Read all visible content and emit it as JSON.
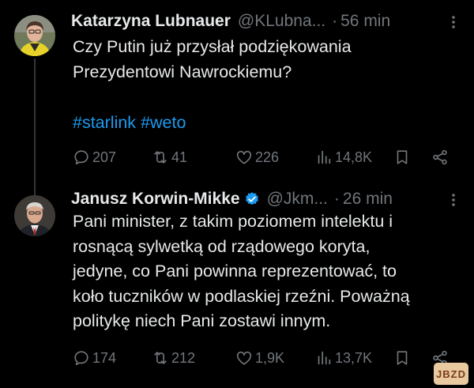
{
  "tweets": [
    {
      "author": "Katarzyna Lubnauer",
      "handle": "@KLubna...",
      "separator": "·",
      "time": "56 min",
      "verified": false,
      "text_lines": [
        "Czy Putin już przysłał podziękowania",
        "Prezydentowi Nawrockiemu?"
      ],
      "hashtags": [
        "#starlink",
        "#weto"
      ],
      "stats": {
        "replies": "207",
        "reposts": "41",
        "likes": "226",
        "views": "14,8K"
      }
    },
    {
      "author": "Janusz Korwin-Mikke",
      "handle": "@Jkm...",
      "separator": "·",
      "time": "26 min",
      "verified": true,
      "text_lines": [
        "Pani minister, z takim poziomem intelektu i",
        "rosnącą sylwetką od rządowego koryta,",
        "jedyne, co Pani powinna reprezentować, to",
        "koło tuczników w podlaskiej rzeźni. Poważną",
        "politykę niech Pani zostawi innym."
      ],
      "stats": {
        "replies": "174",
        "reposts": "212",
        "likes": "1,9K",
        "views": "13,7K"
      }
    }
  ],
  "colors": {
    "background": "#000000",
    "text": "#e7e9ea",
    "muted": "#71767b",
    "link": "#1d9bf0",
    "verified": "#1d9bf0"
  },
  "watermark": "JBZD"
}
